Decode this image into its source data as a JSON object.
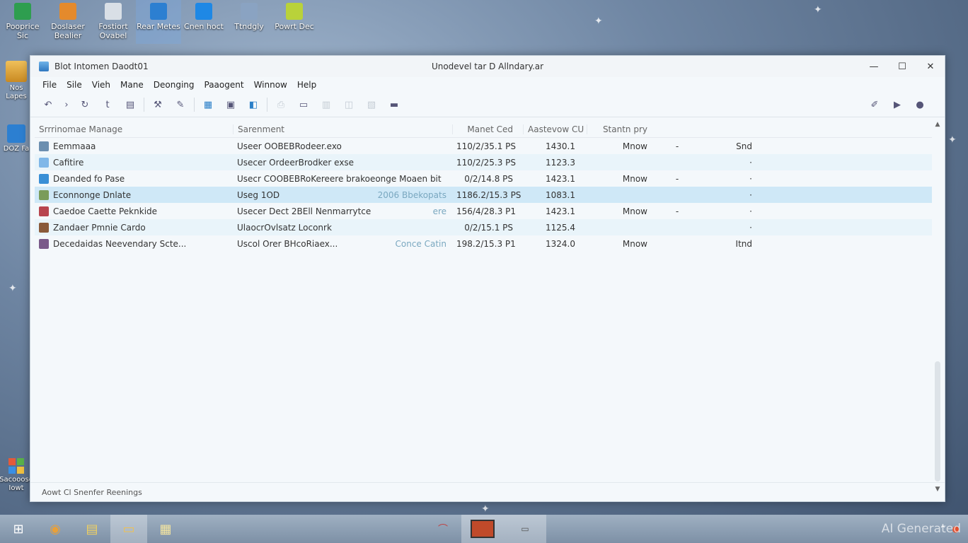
{
  "desktop_top": [
    {
      "label": "Pooprice Sic",
      "icon": "spreadsheet-icon",
      "color": "#2e9e4f"
    },
    {
      "label": "Doslaser Bealier",
      "icon": "folder-icon",
      "color": "#e48a2c"
    },
    {
      "label": "Fostiort Ovabel",
      "icon": "window-icon",
      "color": "#d9dfe6"
    },
    {
      "label": "Rear Metes",
      "icon": "store-icon",
      "color": "#2c7fd1"
    },
    {
      "label": "Cnen hoct",
      "icon": "windows-icon",
      "color": "#1e88e5"
    },
    {
      "label": "Ttndgly",
      "icon": "star-icon",
      "color": "#8aa3c2"
    },
    {
      "label": "Powrt Dec",
      "icon": "pen-icon",
      "color": "#b9d23a"
    }
  ],
  "desktop_left": [
    {
      "label": "Nos Lapes",
      "icon": "folder-icon"
    },
    {
      "label": "DOZ Fa",
      "icon": "app-icon"
    },
    {
      "label": "Sacooose Iowt",
      "icon": "windows-logo-icon"
    }
  ],
  "window": {
    "left_title": "Blot Intomen Daodt01",
    "center_title": "Unodevel tar D Allndary.ar",
    "controls": {
      "minimize": "—",
      "maximize": "☐",
      "close": "✕"
    }
  },
  "menu": [
    "File",
    "Sile",
    "Vieh",
    "Mane",
    "Deonging",
    "Paaogent",
    "Winnow",
    "Help"
  ],
  "columns": [
    "Srrrinomae Manage",
    "Sarenment",
    "Manet Ced",
    "Aastevow CU",
    "Stantn pry",
    "",
    ""
  ],
  "rows": [
    {
      "name": "Eemmaaa",
      "command": "Useer OOBEBRodeer.exo",
      "sub": "",
      "c3": "110/2/35.1 PS",
      "c4": "1430.1",
      "c5": "Mnow",
      "c6": "-",
      "c7": "Snd",
      "icon_color": "#6c8fb0"
    },
    {
      "name": "Cafitire",
      "command": "Usecer OrdeerBrodker exse",
      "sub": "",
      "c3": "110/2/25.3 PS",
      "c4": "1123.3",
      "c5": "",
      "c6": "",
      "c7": "·",
      "icon_color": "#7fb7e8"
    },
    {
      "name": "Deanded fo Pase",
      "command": "Usecr COOBEBRoKereere brakoeonge Moaen bit",
      "sub": "",
      "c3": "0/2/14.8 PS",
      "c4": "1423.1",
      "c5": "Mnow",
      "c6": "-",
      "c7": "·",
      "icon_color": "#3a8fd6"
    },
    {
      "name": "Econnonge Dnlate",
      "command": "Useg 1OD",
      "sub": "2006 Bbekopats",
      "c3": "1186.2/15.3 PS",
      "c4": "1083.1",
      "c5": "",
      "c6": "",
      "c7": "·",
      "icon_color": "#7a9c5a"
    },
    {
      "name": "Caedoe Caette Peknkide",
      "command": "Usecer Dect 2BEll Nenmarrytce",
      "sub": "ere",
      "c3": "156/4/28.3 P1",
      "c4": "1423.1",
      "c5": "Mnow",
      "c6": "-",
      "c7": "·",
      "icon_color": "#b8454e"
    },
    {
      "name": "Zandaer Pmnie Cardo",
      "command": "UlaocrOvlsatz Loconrk",
      "sub": "",
      "c3": "0/2/15.1 PS",
      "c4": "1125.4",
      "c5": "",
      "c6": "",
      "c7": "·",
      "icon_color": "#8a5a3a"
    },
    {
      "name": "Decedaidas Neevendary Scte...",
      "command": "Uscol Orer BHcoRiaex...",
      "sub": "Conce Catin",
      "c3": "198.2/15.3 P1",
      "c4": "1324.0",
      "c5": "Mnow",
      "c6": "",
      "c7": "Itnd",
      "icon_color": "#7a5a8a"
    }
  ],
  "status": "Aowt Cl Snenfer Reenings",
  "taskbar": [
    {
      "icon": "start-icon",
      "glyph": "⊞"
    },
    {
      "icon": "browser-icon",
      "glyph": "◉"
    },
    {
      "icon": "notes-icon",
      "glyph": "▤"
    },
    {
      "icon": "file-explorer-icon",
      "glyph": "▭"
    },
    {
      "icon": "document-icon",
      "glyph": "▦"
    }
  ],
  "tray": {
    "watermark": "AI Generated"
  }
}
